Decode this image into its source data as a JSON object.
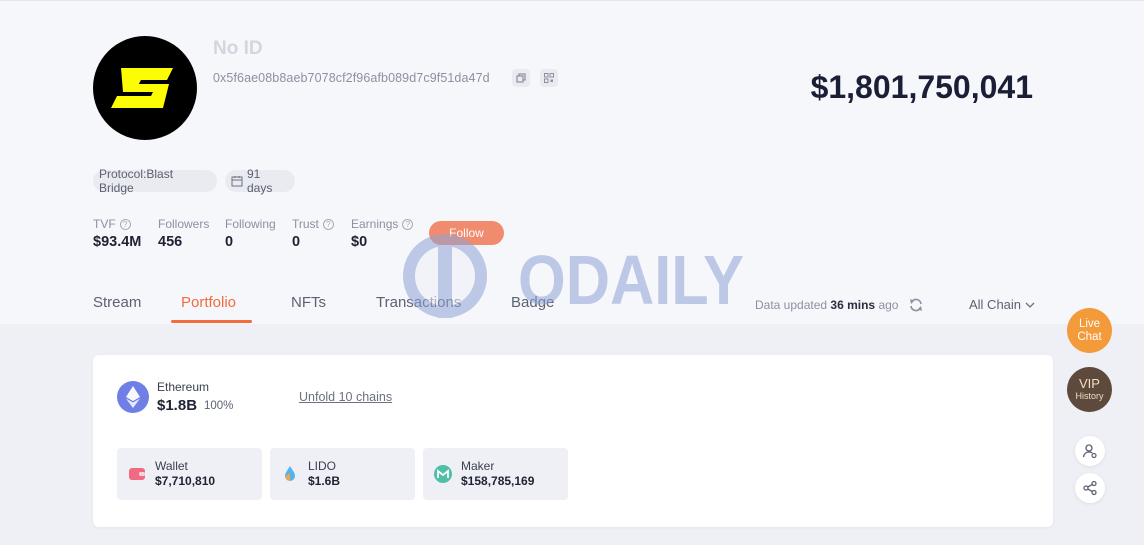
{
  "profile": {
    "name": "No ID",
    "address": "0x5f6ae08b8aeb7078cf2f96afb089d7c9f51da47d",
    "total_value": "$1,801,750,041",
    "tags": {
      "protocol": "Protocol:Blast Bridge",
      "days": "91 days"
    },
    "stats": [
      {
        "label": "TVF",
        "value": "$93.4M"
      },
      {
        "label": "Followers",
        "value": "456"
      },
      {
        "label": "Following",
        "value": "0"
      },
      {
        "label": "Trust",
        "value": "0"
      },
      {
        "label": "Earnings",
        "value": "$0"
      }
    ],
    "follow_label": "Follow"
  },
  "tabs": [
    {
      "label": "Stream",
      "active": false
    },
    {
      "label": "Portfolio",
      "active": true
    },
    {
      "label": "NFTs",
      "active": false
    },
    {
      "label": "Transactions",
      "active": false
    },
    {
      "label": "Badge",
      "active": false
    }
  ],
  "update_info": {
    "prefix": "Data updated",
    "time": "36 mins",
    "suffix": "ago"
  },
  "chain_filter": "All Chain",
  "watermark": "ODAILY",
  "portfolio": {
    "chain": {
      "name": "Ethereum",
      "value": "$1.8B",
      "percent": "100%"
    },
    "unfold_label": "Unfold 10 chains",
    "protocols": [
      {
        "name": "Wallet",
        "value": "$7,710,810",
        "icon": "wallet-icon"
      },
      {
        "name": "LIDO",
        "value": "$1.6B",
        "icon": "lido-icon"
      },
      {
        "name": "Maker",
        "value": "$158,785,169",
        "icon": "maker-icon"
      }
    ]
  },
  "side": {
    "live_chat_line1": "Live",
    "live_chat_line2": "Chat",
    "vip_line1": "VIP",
    "vip_line2": "History"
  },
  "colors": {
    "accent": "#f36c3d",
    "follow": "#f07a55",
    "ethereum": "#6f7fe6",
    "live_chat": "#f39a3a",
    "vip": "#5d4a3c"
  }
}
